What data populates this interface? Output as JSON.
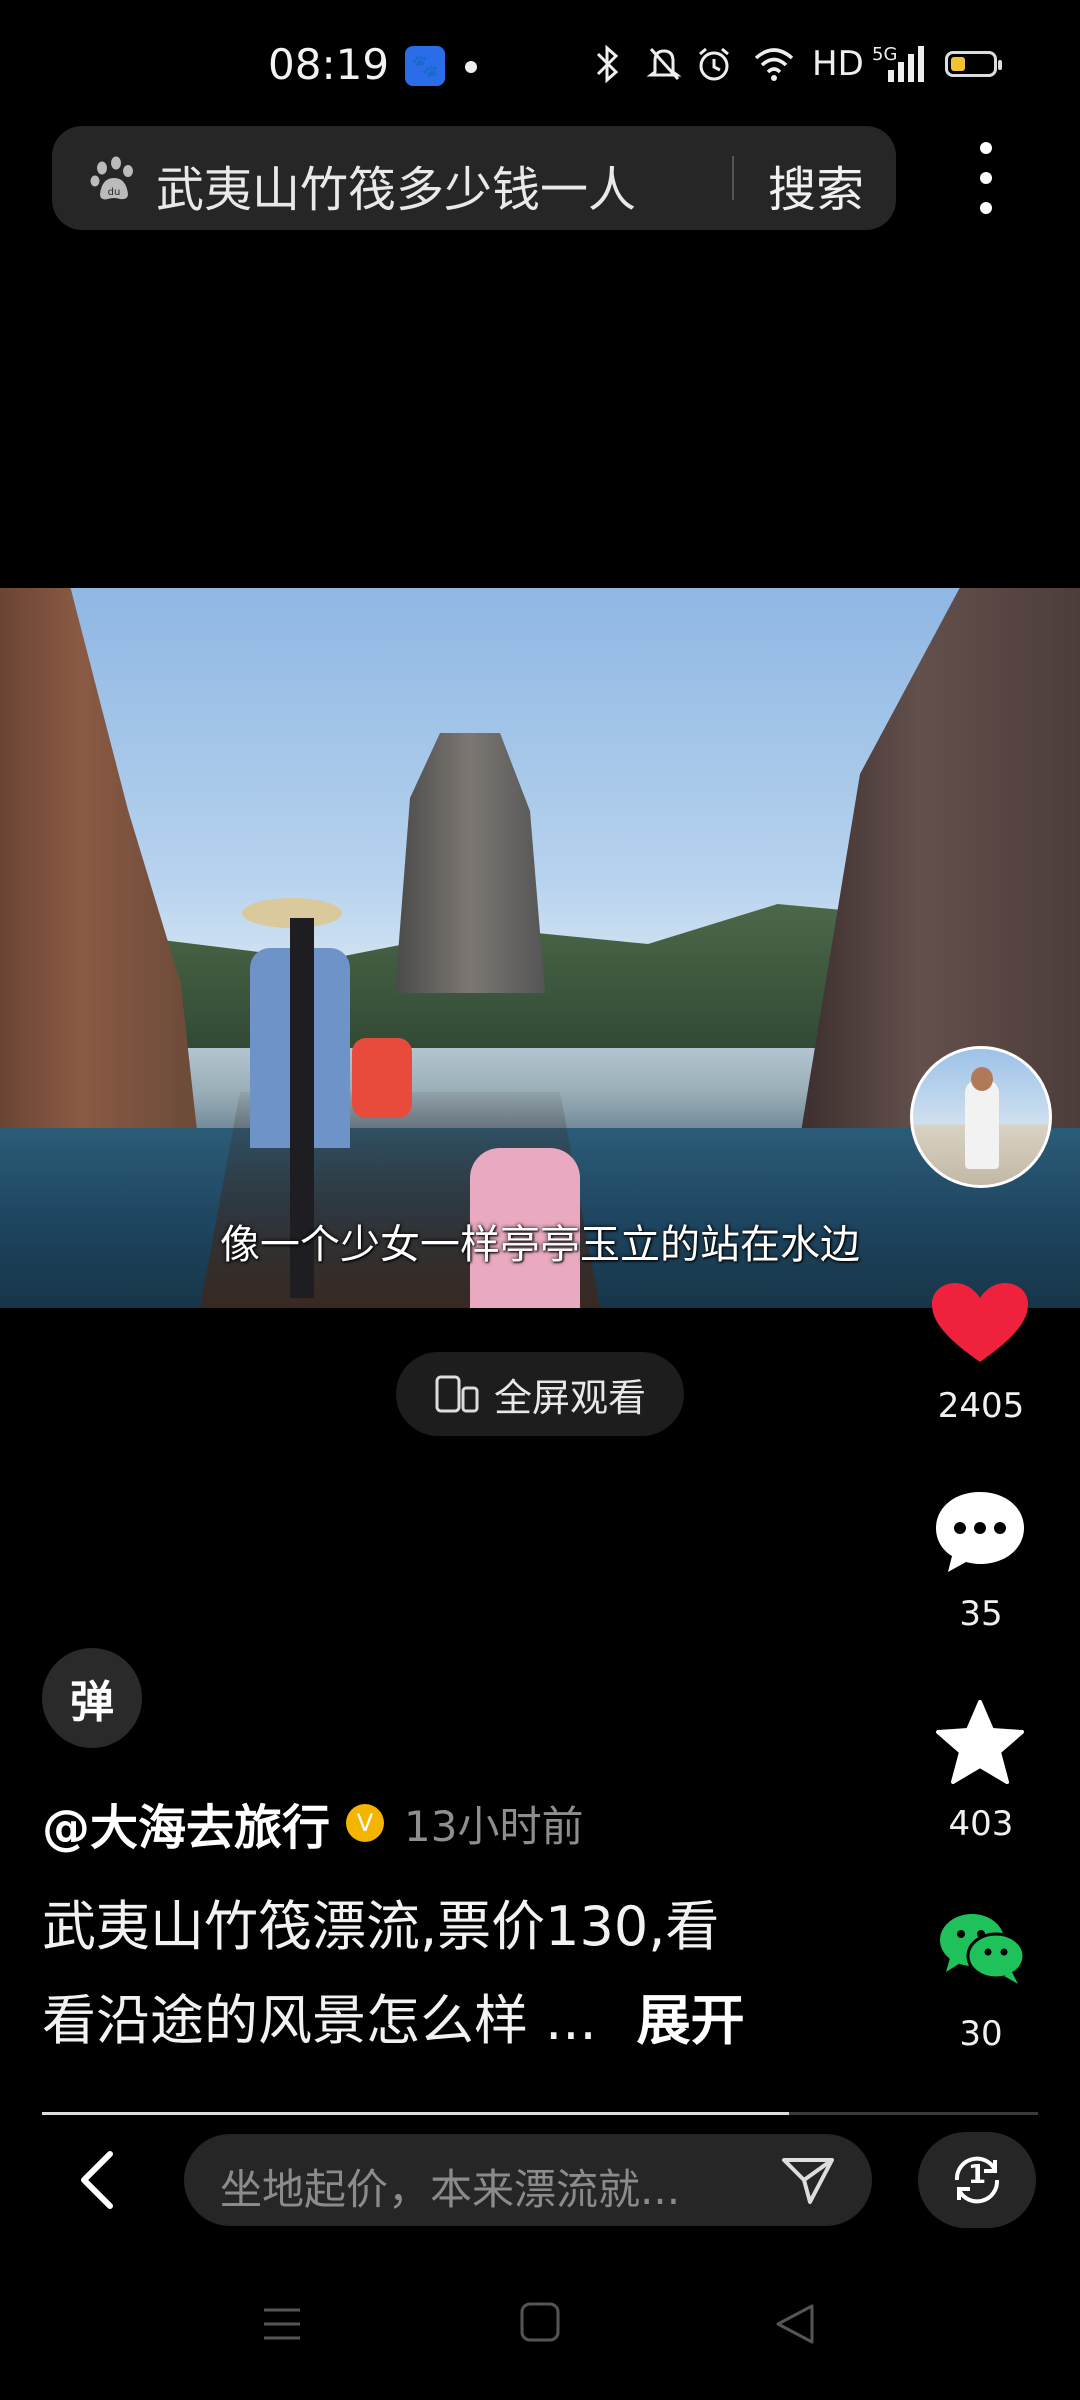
{
  "status_bar": {
    "time": "08:19",
    "hd_label": "HD",
    "network_label": "5G",
    "icons": [
      "baidu-app-icon",
      "notification-dot",
      "bluetooth-icon",
      "mute-icon",
      "alarm-icon",
      "wifi-icon",
      "signal-icon",
      "battery-icon"
    ]
  },
  "search": {
    "query": "武夷山竹筏多少钱一人",
    "button_label": "搜索"
  },
  "video": {
    "subtitle": "像一个少女一样亭亭玉立的站在水边",
    "fullscreen_label": "全屏观看"
  },
  "rail": {
    "likes": "2405",
    "comments": "35",
    "favorites": "403",
    "shares": "30"
  },
  "post": {
    "danmu_label": "弹",
    "author": "@大海去旅行",
    "verified_mark": "V",
    "time_ago": "13小时前",
    "description_line1": "武夷山竹筏漂流,票价130,看",
    "description_line2": "看沿途的风景怎么样 ...",
    "expand_label": "展开",
    "progress": 0.75
  },
  "bottom": {
    "comment_placeholder": "坐地起价，本来漂流就...",
    "copy_badge": "1"
  },
  "colors": {
    "like": "#f0213d",
    "wechat": "#1fc15a",
    "verified": "#f5b400"
  }
}
